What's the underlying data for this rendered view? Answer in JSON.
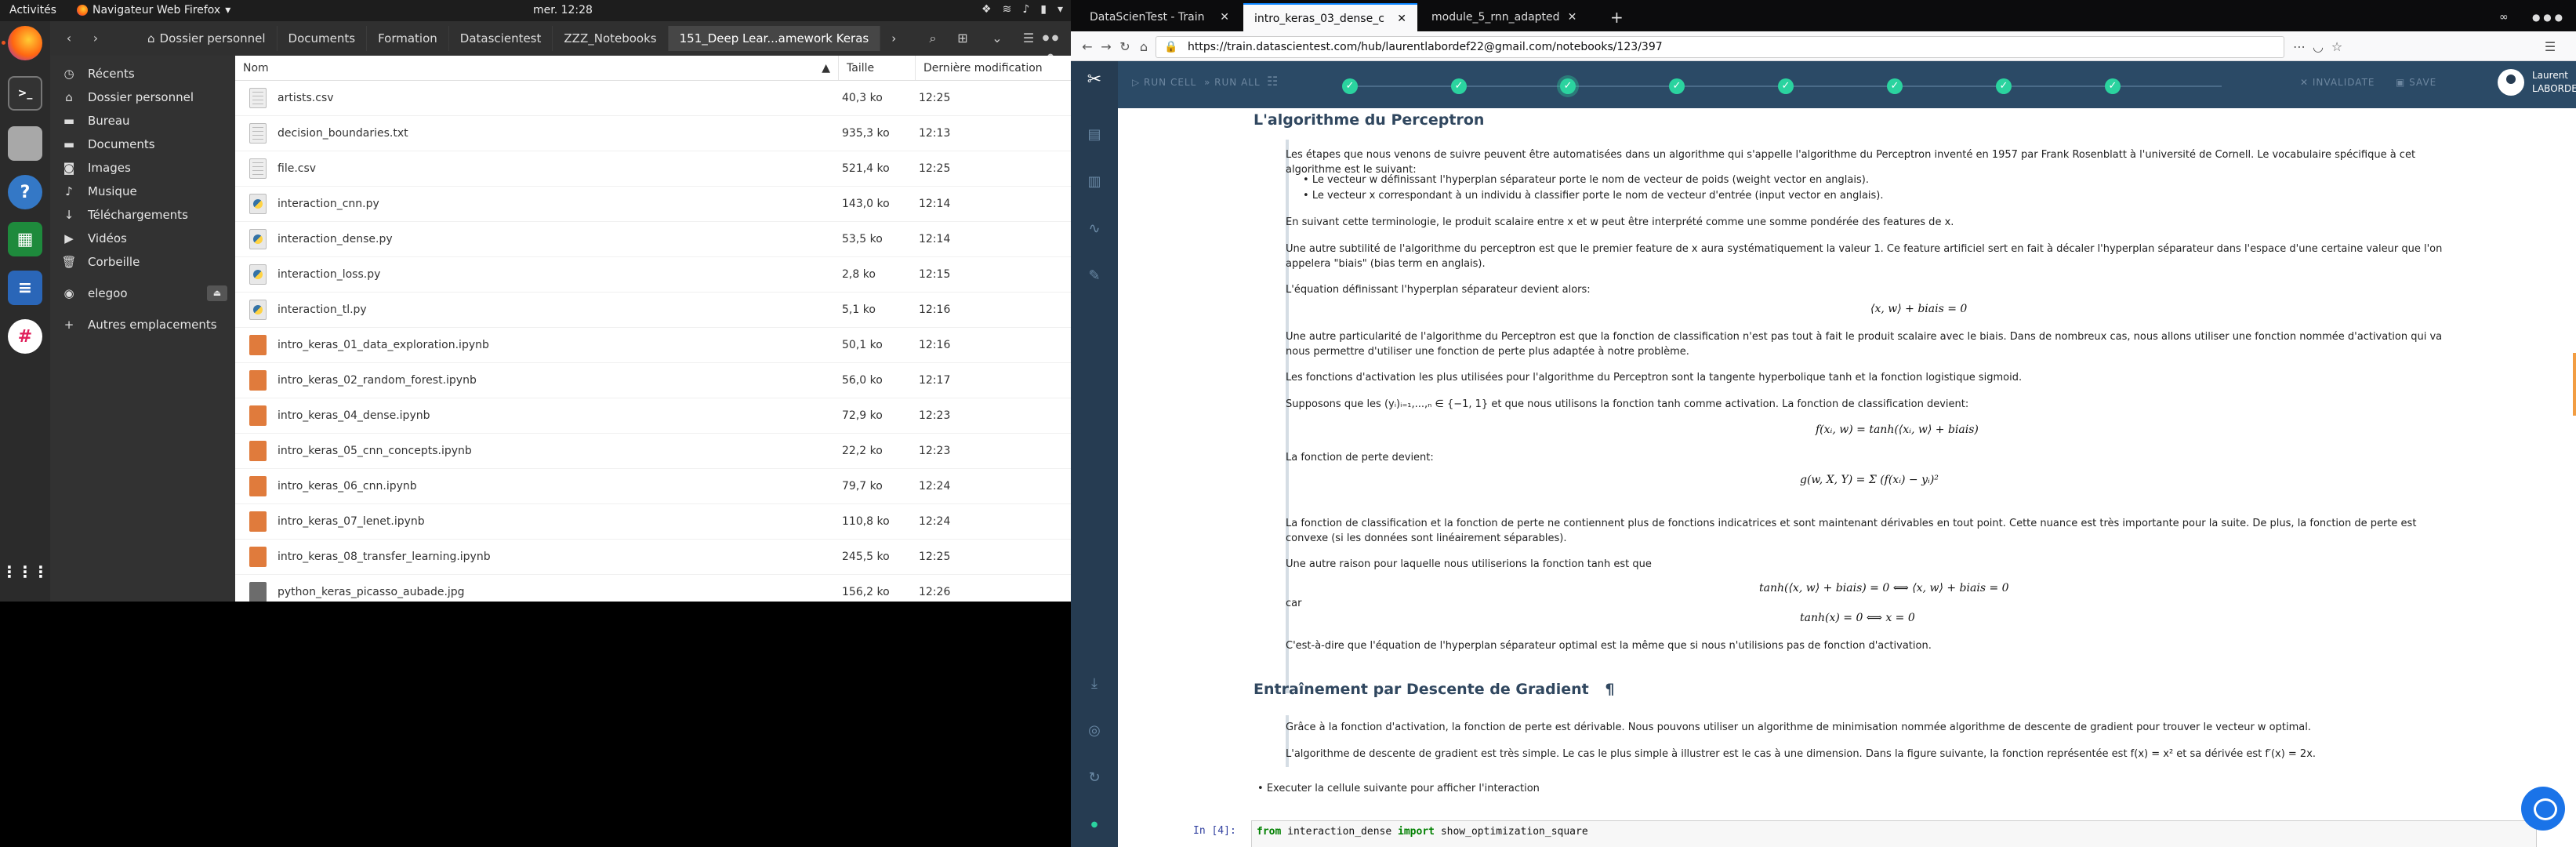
{
  "topbar": {
    "activities": "Activités",
    "app_name": "Navigateur Web Firefox",
    "clock": "mer. 12:28"
  },
  "dock": {
    "items": [
      {
        "name": "firefox-icon"
      },
      {
        "name": "terminal-icon"
      },
      {
        "name": "files-icon"
      },
      {
        "name": "help-icon"
      },
      {
        "name": "libreoffice-calc-icon"
      },
      {
        "name": "libreoffice-writer-icon"
      },
      {
        "name": "slack-icon"
      },
      {
        "name": "show-applications-icon"
      }
    ]
  },
  "nautilus": {
    "breadcrumbs": [
      "Dossier personnel",
      "Documents",
      "Formation",
      "Datascientest",
      "ZZZ_Notebooks",
      "151_Deep Lear...amework Keras"
    ],
    "sidebar": [
      {
        "label": "Récents",
        "icon": "clock-icon"
      },
      {
        "label": "Dossier personnel",
        "icon": "home-icon"
      },
      {
        "label": "Bureau",
        "icon": "folder-icon"
      },
      {
        "label": "Documents",
        "icon": "folder-icon"
      },
      {
        "label": "Images",
        "icon": "camera-icon"
      },
      {
        "label": "Musique",
        "icon": "music-icon"
      },
      {
        "label": "Téléchargements",
        "icon": "download-icon"
      },
      {
        "label": "Vidéos",
        "icon": "video-icon"
      },
      {
        "label": "Corbeille",
        "icon": "trash-icon"
      },
      {
        "label": "elegoo",
        "icon": "drive-icon"
      },
      {
        "label": "Autres emplacements",
        "icon": "plus-icon"
      }
    ],
    "columns": {
      "name": "Nom",
      "size": "Taille",
      "modified": "Dernière modification"
    },
    "files": [
      {
        "name": "artists.csv",
        "size": "40,3 ko",
        "modified": "12:25",
        "type": "txt"
      },
      {
        "name": "decision_boundaries.txt",
        "size": "935,3 ko",
        "modified": "12:13",
        "type": "txt"
      },
      {
        "name": "file.csv",
        "size": "521,4 ko",
        "modified": "12:25",
        "type": "txt"
      },
      {
        "name": "interaction_cnn.py",
        "size": "143,0 ko",
        "modified": "12:14",
        "type": "py"
      },
      {
        "name": "interaction_dense.py",
        "size": "53,5 ko",
        "modified": "12:14",
        "type": "py"
      },
      {
        "name": "interaction_loss.py",
        "size": "2,8 ko",
        "modified": "12:15",
        "type": "py"
      },
      {
        "name": "interaction_tl.py",
        "size": "5,1 ko",
        "modified": "12:16",
        "type": "py"
      },
      {
        "name": "intro_keras_01_data_exploration.ipynb",
        "size": "50,1 ko",
        "modified": "12:16",
        "type": "nb"
      },
      {
        "name": "intro_keras_02_random_forest.ipynb",
        "size": "56,0 ko",
        "modified": "12:17",
        "type": "nb"
      },
      {
        "name": "intro_keras_04_dense.ipynb",
        "size": "72,9 ko",
        "modified": "12:23",
        "type": "nb"
      },
      {
        "name": "intro_keras_05_cnn_concepts.ipynb",
        "size": "22,2 ko",
        "modified": "12:23",
        "type": "nb"
      },
      {
        "name": "intro_keras_06_cnn.ipynb",
        "size": "79,7 ko",
        "modified": "12:24",
        "type": "nb"
      },
      {
        "name": "intro_keras_07_lenet.ipynb",
        "size": "110,8 ko",
        "modified": "12:24",
        "type": "nb"
      },
      {
        "name": "intro_keras_08_transfer_learning.ipynb",
        "size": "245,5 ko",
        "modified": "12:25",
        "type": "nb"
      },
      {
        "name": "python_keras_picasso_aubade.jpg",
        "size": "156,2 ko",
        "modified": "12:26",
        "type": "img"
      }
    ]
  },
  "firefox": {
    "tabs": [
      "DataScienTest - Train",
      "intro_keras_03_dense_c",
      "module_5_rnn_adapted"
    ],
    "url": "https://train.datascientest.com/hub/laurentlabordef22@gmail.com/notebooks/123/397",
    "toolbar": {
      "run_cell": "RUN CELL",
      "run_all": "RUN ALL",
      "invalidate": "INVALIDATE",
      "save": "SAVE"
    },
    "user": {
      "first": "Laurent",
      "last": "LABORDE"
    }
  },
  "notebook": {
    "h_perceptron": "L'algorithme du Perceptron",
    "p1": "Les étapes que nous venons de suivre peuvent être automatisées dans un algorithme qui s'appelle l'algorithme du Perceptron inventé en 1957 par Frank Rosenblatt à l'université de Cornell. Le vocabulaire spécifique à cet algorithme est le suivant:",
    "bullet1": "Le vecteur w définissant l'hyperplan séparateur porte le nom de vecteur de poids (weight vector en anglais).",
    "bullet2": "Le vecteur x correspondant à un individu à classifier porte le nom de vecteur d'entrée (input vector en anglais).",
    "p2": "En suivant cette terminologie, le produit scalaire entre x et w peut être interprété comme une somme pondérée des features de x.",
    "p3": "Une autre subtilité de l'algorithme du perceptron est que le premier feature de x aura systématiquement la valeur 1. Ce feature artificiel sert en fait à décaler l'hyperplan séparateur dans l'espace d'une certaine valeur que l'on appelera \"biais\" (bias term en anglais).",
    "p4": "L'équation définissant l'hyperplan séparateur devient alors:",
    "eq1": "⟨x, w⟩ + biais = 0",
    "p5": "Une autre particularité de l'algorithme du Perceptron est que la fonction de classification n'est pas tout à fait le produit scalaire avec le biais. Dans de nombreux cas, nous allons utiliser une fonction nommée d'activation qui va nous permettre d'utiliser une fonction de perte plus adaptée à notre problème.",
    "p6": "Les fonctions d'activation les plus utilisées pour l'algorithme du Perceptron sont la tangente hyperbolique tanh et la fonction logistique sigmoid.",
    "p7": "Supposons que les (yᵢ)ᵢ₌₁,...,ₙ ∈ {−1, 1} et que nous utilisons la fonction tanh comme activation. La fonction de classification devient:",
    "eq2": "f(xᵢ, w) = tanh(⟨xᵢ, w⟩ + biais)",
    "p8": "La fonction de perte devient:",
    "eq3": "g(w, X, Y) = Σ (f(xᵢ) − yᵢ)²",
    "p9": "La fonction de classification et la fonction de perte ne contiennent plus de fonctions indicatrices et sont maintenant dérivables en tout point. Cette nuance est très importante pour la suite. De plus, la fonction de perte est convexe (si les données sont linéairement séparables).",
    "p10": "Une autre raison pour laquelle nous utiliserions la fonction tanh est que",
    "eq4": "tanh(⟨x, w⟩ + biais) = 0  ⟺  ⟨x, w⟩ + biais = 0",
    "car": "car",
    "eq5": "tanh(x) = 0  ⟺  x = 0",
    "p11": "C'est-à-dire que l'équation de l'hyperplan séparateur optimal est la même que si nous n'utilisions pas de fonction d'activation.",
    "h_descente": "Entraînement par Descente de Gradient",
    "pilcrow": "¶",
    "p12": "Grâce à la fonction d'activation, la fonction de perte est dérivable. Nous pouvons utiliser un algorithme de minimisation nommée algorithme de descente de gradient pour trouver le vecteur w optimal.",
    "p13": "L'algorithme de descente de gradient est très simple. Le cas le plus simple à illustrer est le cas à une dimension. Dans la figure suivante, la fonction représentée est f(x) = x² et sa dérivée est f′(x) = 2x.",
    "bullet3": "Executer la cellule suivante pour afficher l'interaction",
    "prompt": "In [4]:",
    "code": "from interaction_dense import show_optimization_square"
  }
}
